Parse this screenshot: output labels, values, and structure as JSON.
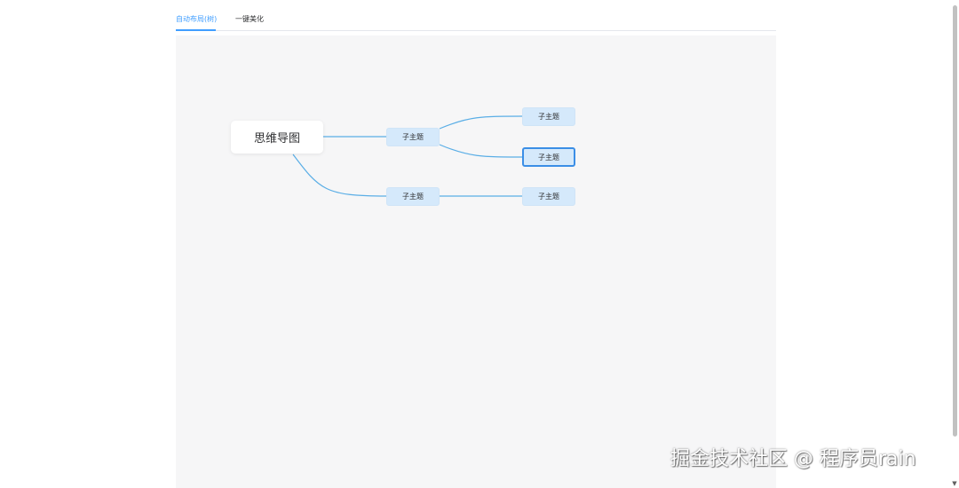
{
  "tabs": [
    {
      "label": "自动布局(树)",
      "active": true
    },
    {
      "label": "一键美化",
      "active": false
    }
  ],
  "mindmap": {
    "root": {
      "label": "思维导图"
    },
    "branches": [
      {
        "label": "子主题",
        "children": [
          {
            "label": "子主题",
            "selected": false
          },
          {
            "label": "子主题",
            "selected": true
          }
        ]
      },
      {
        "label": "子主题",
        "children": [
          {
            "label": "子主题",
            "selected": false
          }
        ]
      }
    ]
  },
  "watermark": "掘金技术社区 @ 程序员rain",
  "colors": {
    "accent": "#409eff",
    "link": "#5aaee6",
    "node_fill": "#d5e9fb",
    "selected_border": "#3b8ee6",
    "canvas_bg": "#f6f6f7"
  },
  "icons": {
    "scroll_down": "▼"
  }
}
